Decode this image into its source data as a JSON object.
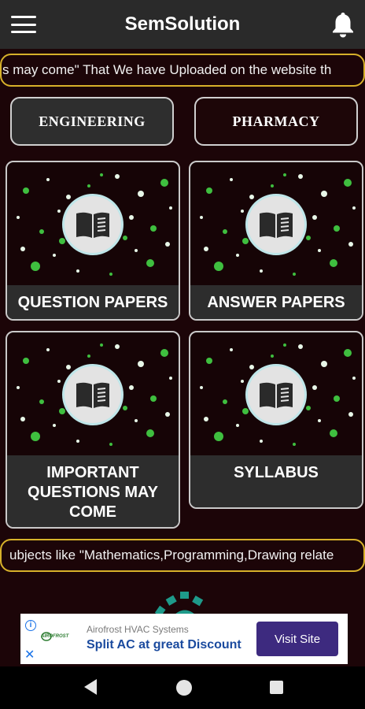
{
  "app": {
    "title": "SemSolution"
  },
  "ticker_top": "s may come\" That We have Uploaded on the website th",
  "ticker_bottom": "ubjects like \"Mathematics,Programming,Drawing relate",
  "tabs": [
    {
      "label": "ENGINEERING",
      "selected": true
    },
    {
      "label": "PHARMACY",
      "selected": false
    }
  ],
  "cards": [
    {
      "label": "QUESTION PAPERS",
      "icon": "book-icon"
    },
    {
      "label": "ANSWER PAPERS",
      "icon": "book-icon"
    },
    {
      "label": "IMPORTANT QUESTIONS MAY COME",
      "icon": "book-icon"
    },
    {
      "label": "SYLLABUS",
      "icon": "book-icon"
    }
  ],
  "ad": {
    "brand": "Airofrost HVAC Systems",
    "headline": "Split AC at great Discount",
    "cta": "Visit Site",
    "logo_text": "AIROFROST"
  },
  "colors": {
    "background": "#1c0508",
    "appbar": "#2a2a2a",
    "ticker_border": "#d7b12a",
    "ad_button": "#3d2a7f",
    "star_green": "#3fbf3f"
  },
  "icons": {
    "menu": "hamburger-icon",
    "notifications": "bell-icon",
    "ad_info": "info-icon",
    "ad_close": "close-icon"
  }
}
